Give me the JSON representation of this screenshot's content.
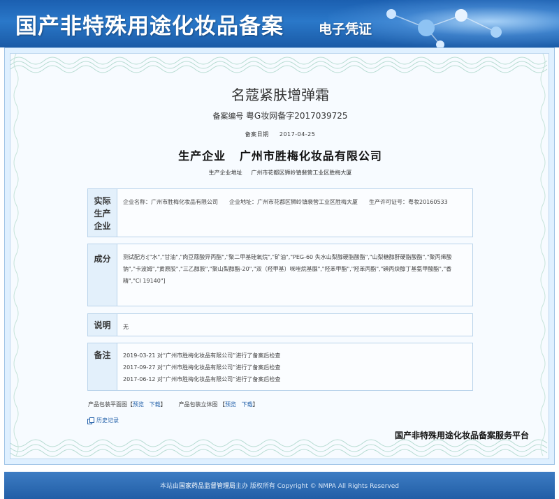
{
  "banner": {
    "title": "国产非特殊用途化妆品备案",
    "subtitle": "电子凭证"
  },
  "certificate": {
    "product_name": "名蔻紧肤增弹霜",
    "reg_label": "备案编号",
    "reg_number": "粤G妆网备字2017039725",
    "date_label": "备案日期",
    "date_value": "2017-04-25",
    "company_label": "生产企业",
    "company_name": "广州市胜梅化妆品有限公司",
    "address_label": "生产企业地址",
    "address_value": "广州市花都区狮岭镇裴营工业区胜梅大厦"
  },
  "enterprise": {
    "label": "实际生产企业",
    "label_lines": [
      "实际",
      "生产",
      "企业"
    ],
    "text": "企业名称：广州市胜梅化妆品有限公司　　企业地址：广州市花都区狮岭镇裴营工业区胜梅大厦　　生产许可证号：粤妆20160533"
  },
  "ingredients": {
    "label": "成分",
    "text": "测试配方:[\"水\",\"甘油\",\"肉豆蔻酸异丙酯\",\"聚二甲基硅氧烷\",\"矿油\",\"PEG-60 失水山梨醇硬脂酸酯\",\"山梨糖醇酐硬脂酸酯\",\"聚丙烯酸钠\",\"卡波姆\",\"黄原胶\",\"三乙醇胺\",\"聚山梨醇酯-20\",\"双（羟甲基）咪唑烷基脲\",\"羟苯甲酯\",\"羟苯丙酯\",\"碘丙炔醇丁基氨甲酸酯\",\"香精\",\"CI 19140\"]"
  },
  "explain": {
    "label": "说明",
    "text": "无"
  },
  "remarks": {
    "label": "备注",
    "lines": [
      "2019-03-21 对“广州市胜梅化妆品有限公司”进行了备案后检查",
      "2017-09-27 对“广州市胜梅化妆品有限公司”进行了备案后检查",
      "2017-06-12 对“广州市胜梅化妆品有限公司”进行了备案后检查"
    ]
  },
  "links": {
    "flat_label": "产品包装平面图【",
    "view": "预览",
    "download": "下载",
    "close": "】",
    "solid_label": "产品包装立体图 【",
    "history": "历史记录"
  },
  "platform": "国产非特殊用途化妆品备案服务平台",
  "footer": {
    "prefix": "本站由",
    "owner": "国家药品监督管理局",
    "suffix": "主办 版权所有 Copyright © NMPA All Rights Reserved"
  },
  "colors": {
    "banner": "#1b5fb0",
    "label_bg": "#e3f0fb",
    "link": "#1f5ea8",
    "footer": "#215ea6"
  }
}
